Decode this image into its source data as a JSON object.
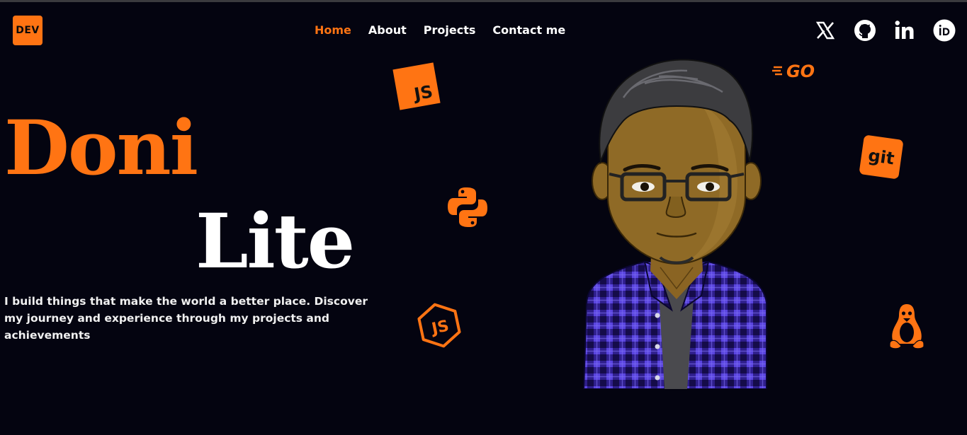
{
  "logo": {
    "text": "DEV"
  },
  "nav": {
    "items": [
      {
        "label": "Home",
        "active": true
      },
      {
        "label": "About",
        "active": false
      },
      {
        "label": "Projects",
        "active": false
      },
      {
        "label": "Contact me",
        "active": false
      }
    ]
  },
  "socials": [
    "x-icon",
    "github-icon",
    "linkedin-icon",
    "orcid-icon"
  ],
  "hero": {
    "name_first": "Doni",
    "name_last": "Lite",
    "tagline": "I build things that make the world a better place. Discover my journey and experience through my projects and achievements"
  },
  "floating_icons": {
    "js": "JS",
    "go": "GO",
    "git": "git",
    "node": "JS"
  },
  "colors": {
    "background": "#040410",
    "accent": "#ff7413",
    "text": "#ffffff"
  }
}
